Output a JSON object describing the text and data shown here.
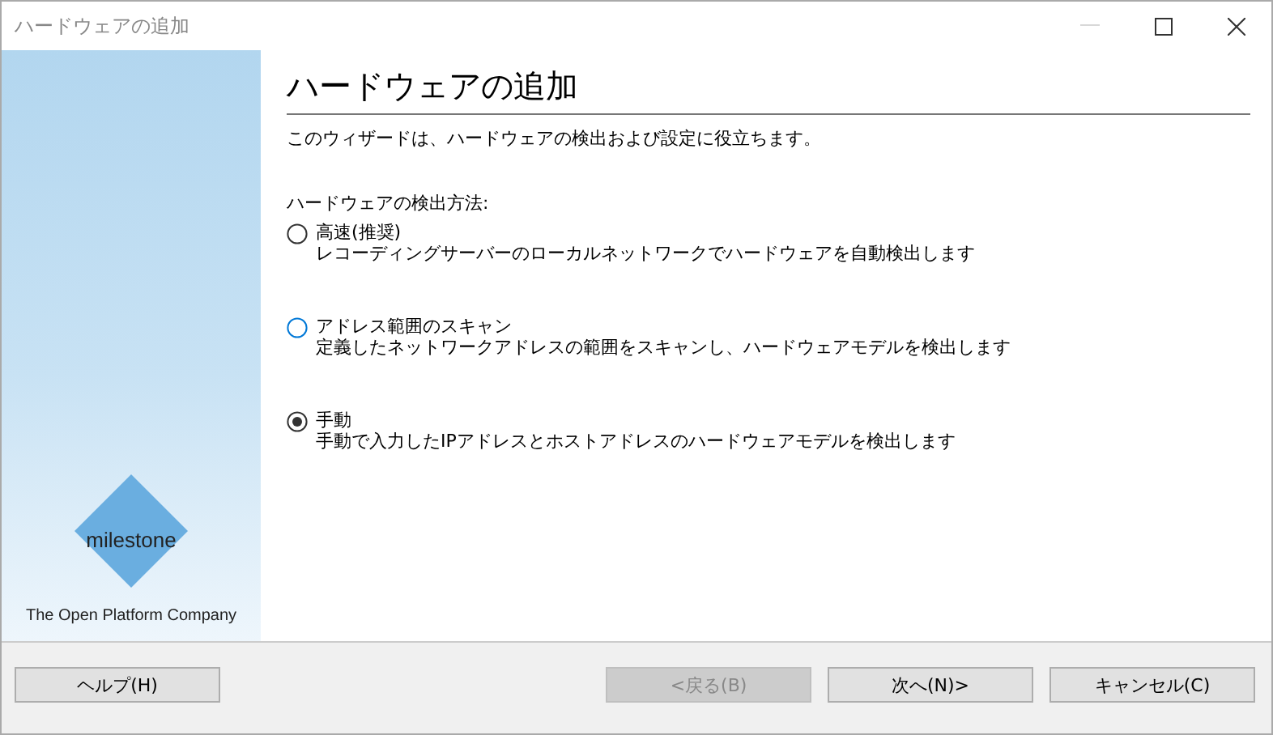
{
  "window": {
    "title": "ハードウェアの追加",
    "minimize_disabled": true
  },
  "sidebar": {
    "logo_text": "milestone",
    "tagline": "The Open Platform Company"
  },
  "heading": "ハードウェアの追加",
  "intro": "このウィザードは、ハードウェアの検出および設定に役立ちます。",
  "group_label": "ハードウェアの検出方法:",
  "options": [
    {
      "label": "高速(推奨)",
      "description": "レコーディングサーバーのローカルネットワークでハードウェアを自動検出します",
      "selected": false,
      "focused": false
    },
    {
      "label": "アドレス範囲のスキャン",
      "description": "定義したネットワークアドレスの範囲をスキャンし、ハードウェアモデルを検出します",
      "selected": false,
      "focused": true
    },
    {
      "label": "手動",
      "description": "手動で入力したIPアドレスとホストアドレスのハードウェアモデルを検出します",
      "selected": true,
      "focused": false
    }
  ],
  "buttons": [
    {
      "label": "ヘルプ(H)",
      "disabled": false
    },
    {
      "label": "<戻る(B)",
      "disabled": true
    },
    {
      "label": "次へ(N)>",
      "disabled": false
    },
    {
      "label": "キャンセル(C)",
      "disabled": false
    }
  ]
}
